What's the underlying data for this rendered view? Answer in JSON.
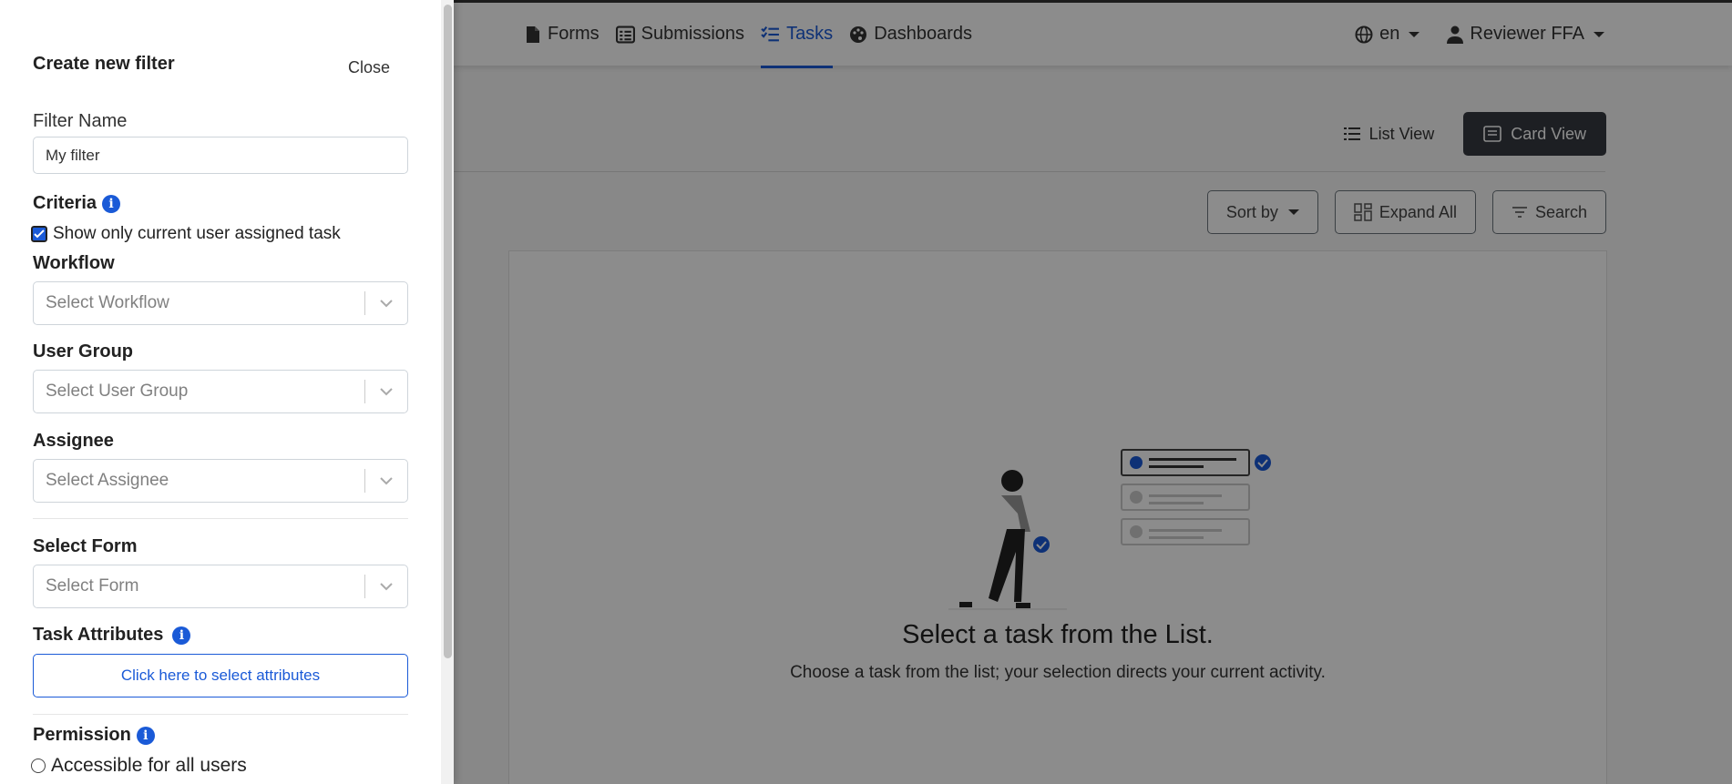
{
  "nav": {
    "items": [
      {
        "label": "Forms",
        "icon": "file-icon"
      },
      {
        "label": "Submissions",
        "icon": "list-alt-icon"
      },
      {
        "label": "Tasks",
        "icon": "tasks-icon",
        "active": true
      },
      {
        "label": "Dashboards",
        "icon": "palette-icon"
      }
    ],
    "language": "en",
    "user": "Reviewer FFA"
  },
  "view": {
    "list_label": "List View",
    "card_label": "Card View"
  },
  "toolbar": {
    "sort_label": "Sort by",
    "expand_label": "Expand All",
    "search_label": "Search"
  },
  "empty_state": {
    "title": "Select a task from the List.",
    "subtitle": "Choose a task from the list; your selection directs your current activity."
  },
  "filter_panel": {
    "title": "Create new filter",
    "close_label": "Close",
    "filter_name_label": "Filter Name",
    "filter_name_value": "My filter",
    "criteria_label": "Criteria",
    "assigned_checkbox_label": "Show only current user assigned task",
    "assigned_checked": true,
    "workflow_label": "Workflow",
    "workflow_placeholder": "Select Workflow",
    "user_group_label": "User Group",
    "user_group_placeholder": "Select User Group",
    "assignee_label": "Assignee",
    "assignee_placeholder": "Select Assignee",
    "select_form_label": "Select Form",
    "select_form_placeholder": "Select Form",
    "task_attributes_label": "Task Attributes",
    "attributes_button": "Click here to select attributes",
    "permission_label": "Permission",
    "permission_option": "Accessible for all users"
  },
  "colors": {
    "accent": "#1a5ad7",
    "dark_button": "#353a40",
    "overlay": "rgba(0,0,0,0.45)"
  }
}
